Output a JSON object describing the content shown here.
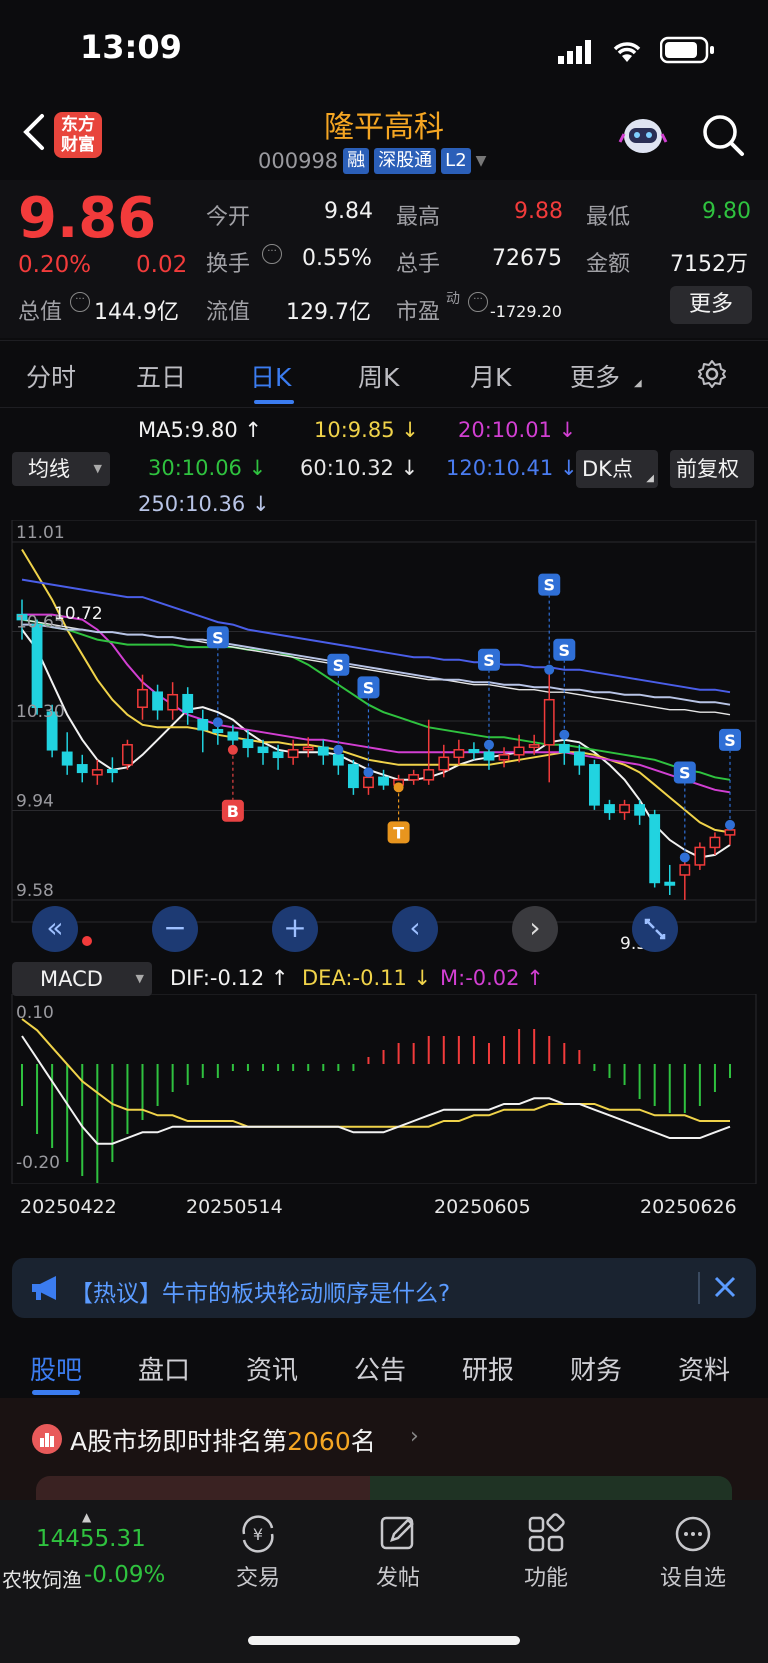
{
  "status_bar": {
    "time": "13:09"
  },
  "header": {
    "logo_text": "东方财富",
    "stock_name": "隆平高科",
    "stock_code": "000998",
    "tags": [
      "融",
      "深股通",
      "L2"
    ]
  },
  "quote": {
    "price": "9.86",
    "change_pct": "0.20%",
    "change": "0.02",
    "open_label": "今开",
    "open": "9.84",
    "high_label": "最高",
    "high": "9.88",
    "low_label": "最低",
    "low": "9.80",
    "turnover_label": "换手",
    "turnover": "0.55%",
    "volume_label": "总手",
    "volume": "72675",
    "amount_label": "金额",
    "amount": "7152万",
    "mcap_label": "总值",
    "mcap": "144.9亿",
    "float_label": "流值",
    "float_cap": "129.7亿",
    "pe_label": "市盈",
    "pe_sup": "动",
    "pe": "-1729.20",
    "more_label": "更多"
  },
  "period_tabs": [
    "分时",
    "五日",
    "日K",
    "周K",
    "月K",
    "更多"
  ],
  "ma_legend": {
    "select_label": "均线",
    "ma5": "MA5:9.80 ↑",
    "ma10": "10:9.85 ↓",
    "ma20": "20:10.01 ↓",
    "ma30": "30:10.06 ↓",
    "ma60": "60:10.32 ↓",
    "ma120": "120:10.41 ↓",
    "ma250": "250:10.36 ↓",
    "dk_label": "DK点",
    "adjust_label": "前复权",
    "colors": {
      "ma5": "#f2f2f2",
      "ma10": "#f0d34a",
      "ma20": "#d23fd2",
      "ma30": "#2fc23f",
      "ma60": "#e6e6e6",
      "ma120": "#4a5ee8",
      "ma250": "#b8c4e6"
    }
  },
  "chart_data": {
    "type": "candlestick",
    "y_ticks": [
      "11.01",
      "10.65",
      "10.30",
      "9.94",
      "9.58"
    ],
    "ylim": [
      9.58,
      11.01
    ],
    "annotation_high": "10.72",
    "annotation_low": "9.58",
    "x_ticks": [
      "20250422",
      "20250514",
      "20250605",
      "20250626"
    ],
    "candles": [
      [
        10.72,
        10.7,
        10.78,
        10.62
      ],
      [
        10.68,
        10.35,
        10.7,
        10.32
      ],
      [
        10.33,
        10.18,
        10.36,
        10.15
      ],
      [
        10.17,
        10.12,
        10.25,
        10.08
      ],
      [
        10.12,
        10.09,
        10.16,
        10.05
      ],
      [
        10.08,
        10.1,
        10.14,
        10.04
      ],
      [
        10.1,
        10.09,
        10.15,
        10.05
      ],
      [
        10.12,
        10.2,
        10.22,
        10.1
      ],
      [
        10.35,
        10.42,
        10.48,
        10.3
      ],
      [
        10.41,
        10.34,
        10.44,
        10.3
      ],
      [
        10.34,
        10.4,
        10.45,
        10.3
      ],
      [
        10.4,
        10.33,
        10.43,
        10.28
      ],
      [
        10.3,
        10.26,
        10.34,
        10.17
      ],
      [
        10.26,
        10.25,
        10.29,
        10.2
      ],
      [
        10.25,
        10.22,
        10.28,
        10.18
      ],
      [
        10.22,
        10.19,
        10.26,
        10.15
      ],
      [
        10.19,
        10.17,
        10.22,
        10.12
      ],
      [
        10.17,
        10.15,
        10.2,
        10.1
      ],
      [
        10.15,
        10.18,
        10.22,
        10.12
      ],
      [
        10.18,
        10.19,
        10.23,
        10.15
      ],
      [
        10.19,
        10.16,
        10.22,
        10.12
      ],
      [
        10.16,
        10.12,
        10.18,
        10.08
      ],
      [
        10.12,
        10.03,
        10.14,
        10.0
      ],
      [
        10.03,
        10.07,
        10.09,
        10.0
      ],
      [
        10.07,
        10.04,
        10.1,
        10.02
      ],
      [
        10.04,
        10.06,
        10.08,
        10.03
      ],
      [
        10.06,
        10.08,
        10.1,
        10.04
      ],
      [
        10.06,
        10.1,
        10.3,
        10.04
      ],
      [
        10.1,
        10.15,
        10.2,
        10.07
      ],
      [
        10.15,
        10.18,
        10.22,
        10.12
      ],
      [
        10.18,
        10.17,
        10.21,
        10.14
      ],
      [
        10.17,
        10.14,
        10.2,
        10.1
      ],
      [
        10.14,
        10.16,
        10.19,
        10.11
      ],
      [
        10.16,
        10.19,
        10.24,
        10.13
      ],
      [
        10.19,
        10.2,
        10.24,
        10.16
      ],
      [
        10.2,
        10.38,
        10.5,
        10.05
      ],
      [
        10.2,
        10.17,
        10.24,
        10.12
      ],
      [
        10.17,
        10.12,
        10.2,
        10.08
      ],
      [
        10.12,
        9.96,
        10.14,
        9.94
      ],
      [
        9.96,
        9.93,
        9.98,
        9.9
      ],
      [
        9.93,
        9.96,
        9.98,
        9.9
      ],
      [
        9.96,
        9.92,
        9.98,
        9.88
      ],
      [
        9.92,
        9.65,
        9.94,
        9.63
      ],
      [
        9.65,
        9.64,
        9.72,
        9.6
      ],
      [
        9.68,
        9.72,
        9.75,
        9.58
      ],
      [
        9.72,
        9.79,
        9.81,
        9.7
      ],
      [
        9.79,
        9.83,
        9.85,
        9.76
      ],
      [
        9.84,
        9.86,
        9.88,
        9.8
      ]
    ],
    "ma_series": {
      "ma5": [
        10.66,
        10.58,
        10.45,
        10.32,
        10.22,
        10.14,
        10.1,
        10.11,
        10.16,
        10.22,
        10.28,
        10.34,
        10.35,
        10.33,
        10.3,
        10.25,
        10.21,
        10.18,
        10.17,
        10.17,
        10.17,
        10.16,
        10.13,
        10.1,
        10.08,
        10.06,
        10.06,
        10.07,
        10.09,
        10.12,
        10.14,
        10.15,
        10.16,
        10.17,
        10.17,
        10.21,
        10.22,
        10.21,
        10.17,
        10.12,
        10.06,
        9.98,
        9.88,
        9.82,
        9.78,
        9.75,
        9.76,
        9.8
      ],
      "ma10": [
        10.98,
        10.88,
        10.78,
        10.66,
        10.56,
        10.46,
        10.38,
        10.32,
        10.28,
        10.27,
        10.27,
        10.27,
        10.26,
        10.24,
        10.23,
        10.22,
        10.21,
        10.21,
        10.2,
        10.2,
        10.19,
        10.18,
        10.16,
        10.14,
        10.13,
        10.12,
        10.12,
        10.12,
        10.12,
        10.12,
        10.12,
        10.12,
        10.13,
        10.14,
        10.15,
        10.16,
        10.17,
        10.17,
        10.16,
        10.14,
        10.12,
        10.09,
        10.04,
        9.99,
        9.94,
        9.89,
        9.86,
        9.85
      ],
      "ma20": [
        10.72,
        10.72,
        10.72,
        10.71,
        10.7,
        10.66,
        10.6,
        10.52,
        10.45,
        10.4,
        10.36,
        10.32,
        10.3,
        10.28,
        10.27,
        10.26,
        10.25,
        10.24,
        10.23,
        10.22,
        10.22,
        10.21,
        10.2,
        10.19,
        10.18,
        10.17,
        10.17,
        10.17,
        10.17,
        10.17,
        10.17,
        10.17,
        10.17,
        10.17,
        10.17,
        10.17,
        10.17,
        10.16,
        10.15,
        10.14,
        10.13,
        10.12,
        10.1,
        10.08,
        10.06,
        10.04,
        10.02,
        10.01
      ],
      "ma30": [
        10.7,
        10.69,
        10.67,
        10.66,
        10.64,
        10.62,
        10.61,
        10.6,
        10.6,
        10.6,
        10.6,
        10.59,
        10.59,
        10.59,
        10.59,
        10.58,
        10.58,
        10.57,
        10.55,
        10.52,
        10.48,
        10.44,
        10.4,
        10.36,
        10.33,
        10.31,
        10.29,
        10.27,
        10.26,
        10.25,
        10.24,
        10.23,
        10.23,
        10.22,
        10.21,
        10.2,
        10.2,
        10.19,
        10.18,
        10.17,
        10.16,
        10.15,
        10.14,
        10.12,
        10.1,
        10.09,
        10.07,
        10.06
      ],
      "ma60": [
        10.7,
        10.69,
        10.68,
        10.67,
        10.66,
        10.65,
        10.65,
        10.64,
        10.64,
        10.63,
        10.63,
        10.62,
        10.61,
        10.6,
        10.59,
        10.58,
        10.57,
        10.56,
        10.55,
        10.54,
        10.53,
        10.52,
        10.51,
        10.5,
        10.49,
        10.48,
        10.47,
        10.46,
        10.46,
        10.45,
        10.44,
        10.44,
        10.43,
        10.42,
        10.42,
        10.41,
        10.41,
        10.4,
        10.39,
        10.38,
        10.37,
        10.36,
        10.35,
        10.34,
        10.34,
        10.33,
        10.33,
        10.32
      ],
      "ma120": [
        10.86,
        10.85,
        10.84,
        10.83,
        10.82,
        10.81,
        10.8,
        10.79,
        10.79,
        10.77,
        10.75,
        10.73,
        10.71,
        10.69,
        10.68,
        10.66,
        10.65,
        10.64,
        10.63,
        10.62,
        10.61,
        10.6,
        10.59,
        10.58,
        10.57,
        10.56,
        10.55,
        10.55,
        10.54,
        10.54,
        10.53,
        10.53,
        10.52,
        10.52,
        10.51,
        10.51,
        10.5,
        10.5,
        10.49,
        10.48,
        10.47,
        10.46,
        10.45,
        10.44,
        10.43,
        10.42,
        10.42,
        10.41
      ],
      "ma250": [
        10.68,
        10.68,
        10.67,
        10.66,
        10.66,
        10.65,
        10.65,
        10.64,
        10.64,
        10.63,
        10.63,
        10.62,
        10.62,
        10.61,
        10.6,
        10.59,
        10.58,
        10.57,
        10.56,
        10.55,
        10.54,
        10.53,
        10.52,
        10.51,
        10.5,
        10.49,
        10.48,
        10.47,
        10.46,
        10.46,
        10.45,
        10.45,
        10.44,
        10.44,
        10.43,
        10.43,
        10.42,
        10.42,
        10.41,
        10.41,
        10.4,
        10.4,
        10.39,
        10.39,
        10.38,
        10.37,
        10.37,
        10.36
      ]
    },
    "signals": [
      {
        "i": 13,
        "label": "S"
      },
      {
        "i": 21,
        "label": "S"
      },
      {
        "i": 23,
        "label": "S"
      },
      {
        "i": 31,
        "label": "S"
      },
      {
        "i": 35,
        "label": "S"
      },
      {
        "i": 36,
        "label": "S"
      },
      {
        "i": 44,
        "label": "S"
      },
      {
        "i": 47,
        "label": "S"
      },
      {
        "i": 14,
        "label": "B"
      },
      {
        "i": 25,
        "label": "T"
      }
    ]
  },
  "macd": {
    "select_label": "MACD",
    "dif": "DIF:-0.12 ↑",
    "dea": "DEA:-0.11 ↓",
    "m": "M:-0.02 ↑",
    "y_ticks": [
      "0.10",
      "-0.20"
    ],
    "ylim": [
      -0.2,
      0.1
    ],
    "dif_series": [
      0.04,
      0.0,
      -0.04,
      -0.08,
      -0.12,
      -0.15,
      -0.15,
      -0.14,
      -0.13,
      -0.13,
      -0.12,
      -0.12,
      -0.12,
      -0.12,
      -0.12,
      -0.12,
      -0.12,
      -0.12,
      -0.12,
      -0.12,
      -0.12,
      -0.12,
      -0.13,
      -0.13,
      -0.13,
      -0.12,
      -0.11,
      -0.1,
      -0.09,
      -0.09,
      -0.09,
      -0.09,
      -0.08,
      -0.08,
      -0.07,
      -0.07,
      -0.08,
      -0.08,
      -0.09,
      -0.1,
      -0.11,
      -0.12,
      -0.13,
      -0.14,
      -0.14,
      -0.14,
      -0.13,
      -0.12
    ],
    "dea_series": [
      0.07,
      0.05,
      0.02,
      -0.01,
      -0.04,
      -0.06,
      -0.08,
      -0.09,
      -0.09,
      -0.1,
      -0.1,
      -0.11,
      -0.11,
      -0.11,
      -0.11,
      -0.12,
      -0.12,
      -0.12,
      -0.12,
      -0.12,
      -0.12,
      -0.12,
      -0.12,
      -0.12,
      -0.12,
      -0.12,
      -0.12,
      -0.12,
      -0.11,
      -0.11,
      -0.1,
      -0.1,
      -0.09,
      -0.09,
      -0.09,
      -0.08,
      -0.08,
      -0.08,
      -0.08,
      -0.09,
      -0.09,
      -0.09,
      -0.1,
      -0.1,
      -0.1,
      -0.11,
      -0.11,
      -0.11
    ],
    "hist": [
      -0.06,
      -0.1,
      -0.12,
      -0.14,
      -0.16,
      -0.17,
      -0.14,
      -0.1,
      -0.08,
      -0.06,
      -0.04,
      -0.03,
      -0.02,
      -0.02,
      -0.01,
      -0.01,
      -0.01,
      -0.01,
      -0.01,
      -0.01,
      -0.01,
      -0.01,
      -0.01,
      0.01,
      0.02,
      0.03,
      0.03,
      0.04,
      0.04,
      0.04,
      0.04,
      0.03,
      0.04,
      0.05,
      0.05,
      0.04,
      0.03,
      0.02,
      -0.01,
      -0.02,
      -0.03,
      -0.05,
      -0.06,
      -0.07,
      -0.07,
      -0.06,
      -0.04,
      -0.02
    ]
  },
  "nav_buttons": [
    "«",
    "−",
    "+",
    "‹",
    "›"
  ],
  "banner": {
    "text": "【热议】牛市的板块轮动顺序是什么?"
  },
  "bottom_tabs": [
    "股吧",
    "盘口",
    "资讯",
    "公告",
    "研报",
    "财务",
    "资料"
  ],
  "rank": {
    "prefix": "A股市场即时排名第",
    "rank": "2060",
    "suffix": "名"
  },
  "index_ticker": {
    "value": "14455.31",
    "name": "农牧饲渔",
    "change": "-0.09%"
  },
  "bottom_bar": [
    "交易",
    "发帖",
    "功能",
    "设自选"
  ]
}
